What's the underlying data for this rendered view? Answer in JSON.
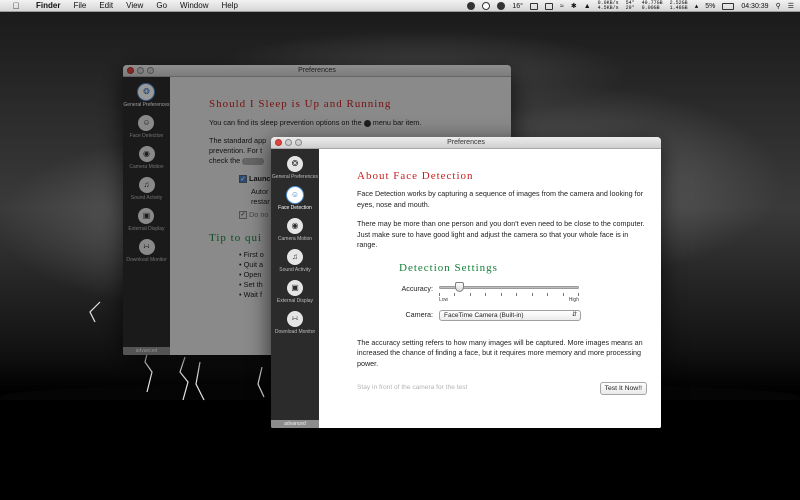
{
  "menubar": {
    "app": "Finder",
    "menus": [
      "File",
      "Edit",
      "View",
      "Go",
      "Window",
      "Help"
    ],
    "temp": "16°",
    "net": [
      "0.0KB/s",
      "4.5KB/s"
    ],
    "cpu": [
      "54°",
      "29°"
    ],
    "disk1": [
      "49.77GB",
      "0.00GB"
    ],
    "disk2": [
      "2.52GB",
      "1.48GB"
    ],
    "battery": "5%",
    "clock": "04:30:39"
  },
  "back_window": {
    "title": "Preferences",
    "sidebar": [
      {
        "label": "General Preferences",
        "icon": "swirl-icon"
      },
      {
        "label": "Face Detection",
        "icon": "face-icon"
      },
      {
        "label": "Camera Motion",
        "icon": "camera-icon"
      },
      {
        "label": "Sound Activity",
        "icon": "microphone-icon"
      },
      {
        "label": "External Display",
        "icon": "monitor-icon"
      },
      {
        "label": "Download Monitor",
        "icon": "rss-icon"
      }
    ],
    "advanced": "advanced",
    "heading": "Should I Sleep is Up and Running",
    "line1": "You can find its sleep prevention options on the",
    "line1_end": "menu bar item.",
    "para2a": "The standard app",
    "para2b": "prevention. For t",
    "para2c": "check the",
    "checkbox1": "Launc",
    "auto_a": "Autor",
    "auto_b": "restar",
    "checkbox2": "Do no",
    "tip_heading": "Tip to qui",
    "tips": [
      "First o",
      "Quit a",
      "Open",
      "Set th",
      "Wait f"
    ]
  },
  "front_window": {
    "title": "Preferences",
    "sidebar": [
      {
        "label": "General Preferences",
        "icon": "swirl-icon"
      },
      {
        "label": "Face Detection",
        "icon": "face-icon"
      },
      {
        "label": "Camera Motion",
        "icon": "camera-icon"
      },
      {
        "label": "Sound Activity",
        "icon": "microphone-icon"
      },
      {
        "label": "External Display",
        "icon": "monitor-icon"
      },
      {
        "label": "Download Monitor",
        "icon": "rss-icon"
      }
    ],
    "selected": "Face Detection",
    "advanced": "advanced",
    "heading": "About Face Detection",
    "para1": "Face Detection works by capturing a sequence of images from the camera and looking for eyes, nose and mouth.",
    "para2": "There may be more than one person and you don't even need to be close to the computer. Just make sure to have good light and adjust the camera so that your whole face is in range.",
    "settings_heading": "Detection Settings",
    "accuracy_label": "Accuracy:",
    "accuracy_value": 0.12,
    "low": "Low",
    "high": "High",
    "camera_label": "Camera:",
    "camera_value": "FaceTime Camera (Built-in)",
    "para3": "The accuracy setting refers to how many images will be captured. More images means an increased the chance of finding a face, but it requires more memory and more processing power.",
    "hint": "Stay in front of the camera for the test",
    "test_button": "Test It Now!!"
  }
}
